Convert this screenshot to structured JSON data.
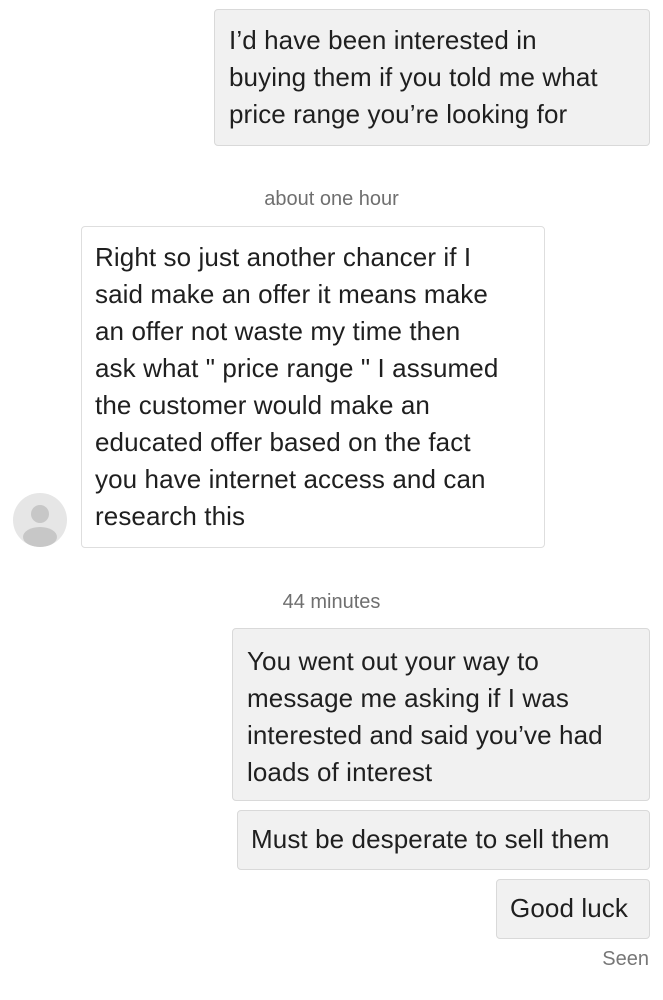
{
  "messages": [
    {
      "direction": "outgoing",
      "lines": [
        "I’d have been interested in",
        "buying them if you told me what",
        "price range you’re looking for"
      ]
    },
    {
      "direction": "incoming",
      "lines": [
        "Right so just another chancer if I",
        "said make an offer it means make",
        "an offer not waste my time then",
        "ask what \" price range \" I assumed",
        "the customer would make an",
        "educated offer based on the fact",
        "you have internet access and can",
        "research this"
      ]
    },
    {
      "direction": "outgoing",
      "lines": [
        "You went out your way to",
        "message me asking if I was",
        "interested and said you’ve had",
        "loads of interest"
      ]
    },
    {
      "direction": "outgoing",
      "lines": [
        "Must be desperate to sell them"
      ]
    },
    {
      "direction": "outgoing",
      "lines": [
        "Good luck"
      ]
    }
  ],
  "timestamps": {
    "first": "about one hour",
    "second": "44 minutes"
  },
  "status": {
    "seen": "Seen"
  },
  "colors": {
    "outgoing_bubble": "#f1f1f1",
    "incoming_bubble": "#ffffff",
    "timestamp_text": "#6f6f6f",
    "avatar_placeholder": "#e6e6e6",
    "avatar_silhouette": "#c7c7c7"
  },
  "icons": {
    "avatar": "default-user-avatar-icon"
  }
}
